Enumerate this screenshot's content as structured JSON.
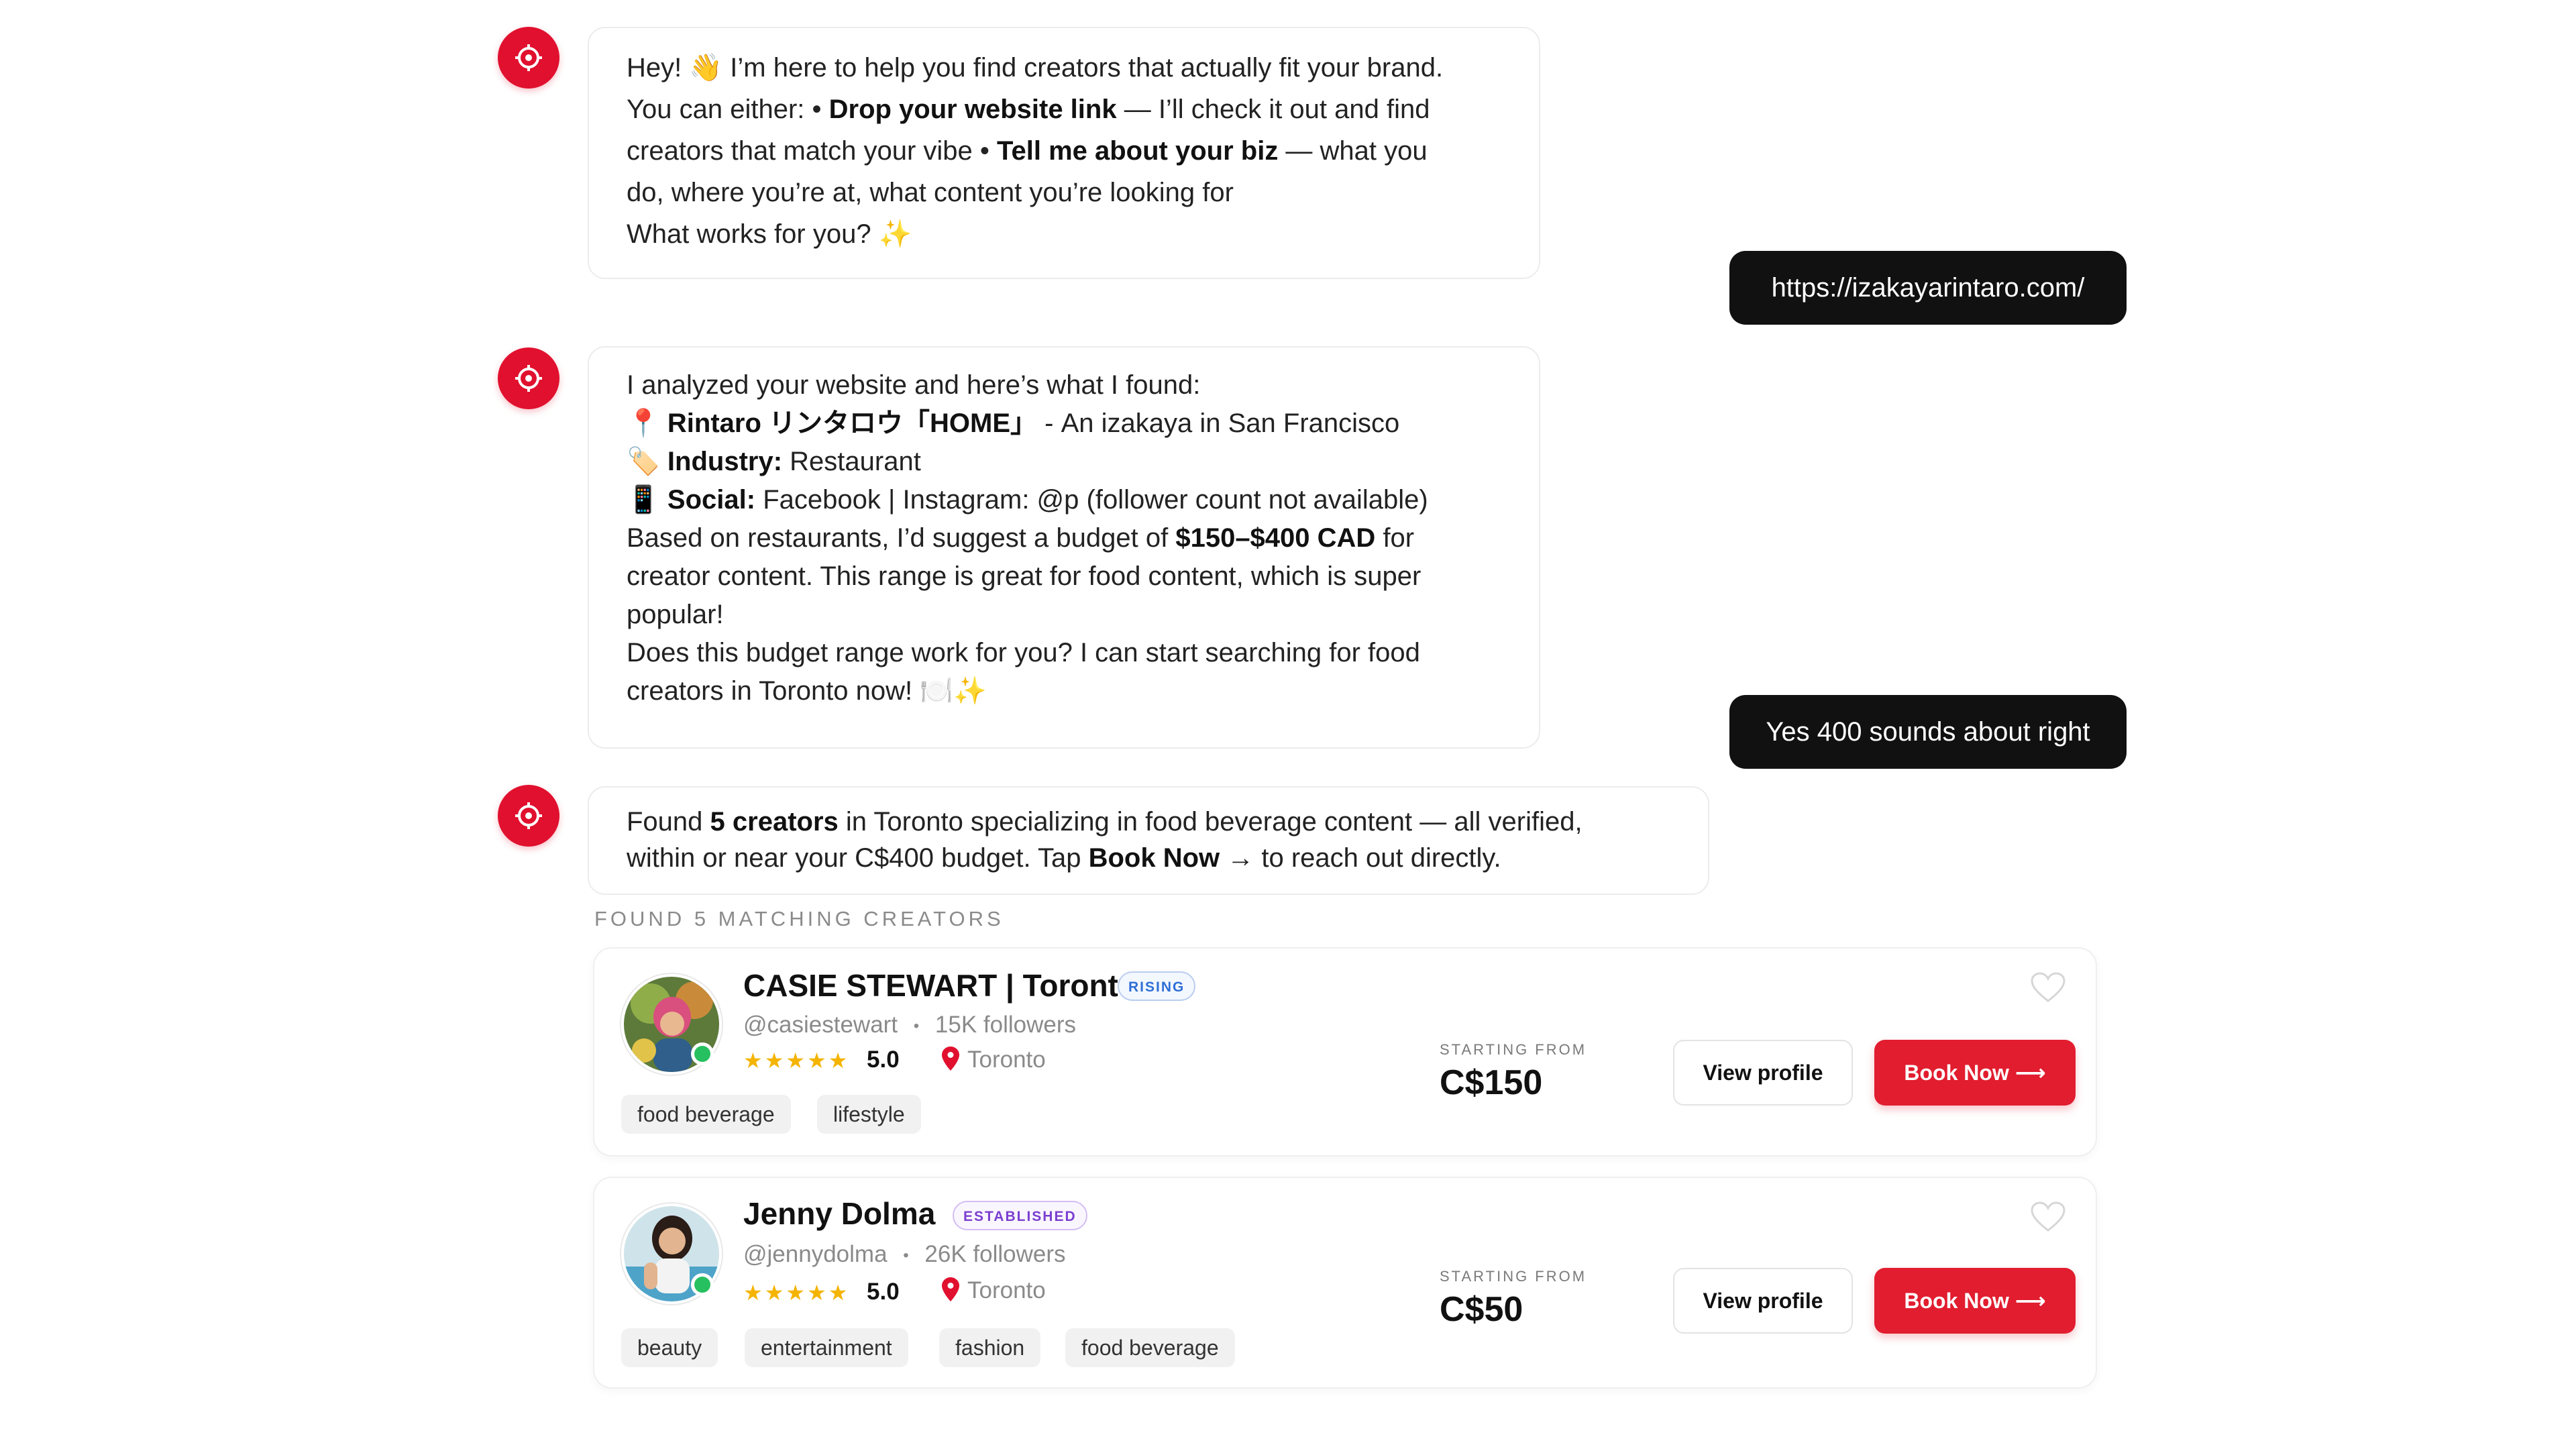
{
  "messages": [
    {
      "lines": [
        [
          {
            "t": "Hey! 👋 I’m here to help you find creators that actually fit your brand."
          }
        ],
        [
          {
            "t": "You can either: • "
          },
          {
            "t": "Drop your website link",
            "b": true
          },
          {
            "t": " — I’ll check it out and find"
          }
        ],
        [
          {
            "t": "creators that match your vibe  • "
          },
          {
            "t": "Tell me about your biz",
            "b": true
          },
          {
            "t": " — what you"
          }
        ],
        [
          {
            "t": "do, where you’re at, what content you’re looking for"
          }
        ],
        [
          {
            "t": "What works for you? ✨"
          }
        ]
      ]
    },
    {
      "lines": [
        [
          {
            "t": "I analyzed your website and here’s what I found:"
          }
        ],
        [
          {
            "t": "📍 "
          },
          {
            "t": "Rintaro リンタロウ「HOME」",
            "b": true
          },
          {
            "t": " - An izakaya in San Francisco"
          }
        ],
        [
          {
            "t": "🏷️ "
          },
          {
            "t": "Industry:",
            "b": true
          },
          {
            "t": " Restaurant"
          }
        ],
        [
          {
            "t": "📱 "
          },
          {
            "t": "Social:",
            "b": true
          },
          {
            "t": " Facebook | Instagram: @p (follower count not available)"
          }
        ],
        [
          {
            "t": "Based on restaurants, I’d suggest a budget of "
          },
          {
            "t": "$150–$400 CAD",
            "b": true
          },
          {
            "t": " for"
          }
        ],
        [
          {
            "t": "creator content. This range is great for food content, which is super"
          }
        ],
        [
          {
            "t": "popular!"
          }
        ],
        [
          {
            "t": "Does this budget range work for you? I can start searching for food"
          }
        ],
        [
          {
            "t": "creators in Toronto now! 🍽️✨"
          }
        ]
      ]
    },
    {
      "lines": [
        [
          {
            "t": "Found "
          },
          {
            "t": "5 creators",
            "b": true
          },
          {
            "t": " in Toronto specializing in food beverage content — all verified,"
          }
        ],
        [
          {
            "t": "within or near your C$400 budget. Tap "
          },
          {
            "t": "Book Now",
            "b": true
          },
          {
            "t": " → to reach out directly."
          }
        ]
      ]
    }
  ],
  "user_messages": [
    "https://izakayarintaro.com/",
    "Yes 400 sounds about right"
  ],
  "results_label": "FOUND 5 MATCHING CREATORS",
  "creators": [
    {
      "name": "CASIE STEWART | Toronto",
      "tier": "RISING",
      "handle": "@casiestewart",
      "followers": "15K followers",
      "stars": "★★★★★",
      "rating": "5.0",
      "location": "Toronto",
      "tags": [
        "food beverage",
        "lifestyle"
      ],
      "starting_from_label": "STARTING FROM",
      "price": "C$150",
      "view_label": "View profile",
      "book_label": "Book Now ⟶"
    },
    {
      "name": "Jenny Dolma",
      "tier": "ESTABLISHED",
      "handle": "@jennydolma",
      "followers": "26K followers",
      "stars": "★★★★★",
      "rating": "5.0",
      "location": "Toronto",
      "tags": [
        "beauty",
        "entertainment",
        "fashion",
        "food beverage"
      ],
      "starting_from_label": "STARTING FROM",
      "price": "C$50",
      "view_label": "View profile",
      "book_label": "Book Now ⟶"
    }
  ],
  "colors": {
    "brand_red": "#e0102e",
    "user_bubble": "#111111",
    "star": "#f4b400",
    "online": "#27c060"
  },
  "icons": [
    "target-icon",
    "pin-icon",
    "heart-icon",
    "arrow-right-icon"
  ]
}
